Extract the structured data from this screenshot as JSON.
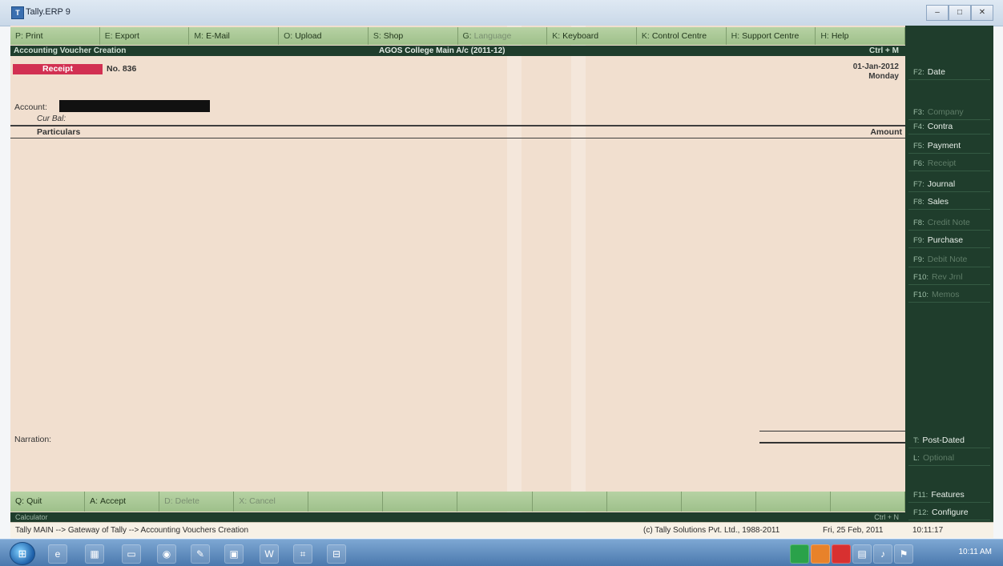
{
  "window": {
    "title": "Tally.ERP 9",
    "controls": {
      "min": "–",
      "max": "□",
      "close": "✕"
    }
  },
  "top_buttons": [
    {
      "key": "P:",
      "label": "Print",
      "dim": false
    },
    {
      "key": "E:",
      "label": "Export",
      "dim": false
    },
    {
      "key": "M:",
      "label": "E-Mail",
      "dim": false
    },
    {
      "key": "O:",
      "label": "Upload",
      "dim": false
    },
    {
      "key": "S:",
      "label": "Shop",
      "dim": false
    },
    {
      "key": "G:",
      "label": "Language",
      "dim": true
    },
    {
      "key": "K:",
      "label": "Keyboard",
      "dim": false
    },
    {
      "key": "K:",
      "label": "Control Centre",
      "dim": false
    },
    {
      "key": "H:",
      "label": "Support Centre",
      "dim": false
    },
    {
      "key": "H:",
      "label": "Help",
      "dim": false
    }
  ],
  "header": {
    "screen_title": "Accounting Voucher Creation",
    "company": "AGOS College Main A/c (2011-12)",
    "shortcut": "Ctrl + M"
  },
  "voucher": {
    "type": "Receipt",
    "number": "No. 836",
    "date": "01-Jan-2012",
    "day": "Monday",
    "account_label": "Account:",
    "current_balance_label": "Cur Bal:",
    "particulars_header": "Particulars",
    "amount_header": "Amount",
    "narration_label": "Narration:"
  },
  "bottom_buttons": [
    {
      "key": "Q:",
      "label": "Quit",
      "dim": false
    },
    {
      "key": "A:",
      "label": "Accept",
      "dim": false
    },
    {
      "key": "D:",
      "label": "Delete",
      "dim": true
    },
    {
      "key": "X:",
      "label": "Cancel",
      "dim": true
    },
    {
      "key": "",
      "label": "",
      "dim": true
    },
    {
      "key": "",
      "label": "",
      "dim": true
    },
    {
      "key": "",
      "label": "",
      "dim": true
    },
    {
      "key": "",
      "label": "",
      "dim": true
    },
    {
      "key": "",
      "label": "",
      "dim": true
    },
    {
      "key": "",
      "label": "",
      "dim": true
    },
    {
      "key": "",
      "label": "",
      "dim": true
    },
    {
      "key": "",
      "label": "",
      "dim": true
    }
  ],
  "bottom_strip": {
    "left": "Calculator",
    "right": "Ctrl + N"
  },
  "status_bar": {
    "path": "Tally MAIN --> Gateway of Tally --> Accounting Vouchers Creation",
    "copyright": "(c) Tally Solutions Pvt. Ltd., 1988-2011",
    "date": "Fri, 25 Feb, 2011",
    "time": "10:11:17"
  },
  "right_panel": [
    {
      "key": "F2:",
      "label": "Date",
      "dim": false,
      "y": 0
    },
    {
      "key": "F3:",
      "label": "Company",
      "dim": true,
      "y": 1
    },
    {
      "key": "F4:",
      "label": "Contra",
      "dim": false,
      "y": 2
    },
    {
      "key": "F5:",
      "label": "Payment",
      "dim": false,
      "y": 3
    },
    {
      "key": "F6:",
      "label": "Receipt",
      "dim": true,
      "y": 4
    },
    {
      "key": "F7:",
      "label": "Journal",
      "dim": false,
      "y": 5
    },
    {
      "key": "F8:",
      "label": "Sales",
      "dim": false,
      "y": 6
    },
    {
      "key": "F8:",
      "label": "Credit Note",
      "dim": true,
      "y": 7
    },
    {
      "key": "F9:",
      "label": "Purchase",
      "dim": false,
      "y": 8
    },
    {
      "key": "F9:",
      "label": "Debit Note",
      "dim": true,
      "y": 9
    },
    {
      "key": "F10:",
      "label": "Rev Jrnl",
      "dim": true,
      "y": 10
    },
    {
      "key": "F10:",
      "label": "Memos",
      "dim": true,
      "y": 11
    }
  ],
  "right_panel_bottom": [
    {
      "key": "T:",
      "label": "Post-Dated",
      "dim": false
    },
    {
      "key": "L:",
      "label": "Optional",
      "dim": true
    },
    {
      "key": "F11:",
      "label": "Features",
      "dim": false
    },
    {
      "key": "F12:",
      "label": "Configure",
      "dim": false
    }
  ],
  "taskbar": {
    "start": "⊞",
    "icons": [
      "e",
      "▦",
      "▭",
      "◉",
      "✎",
      "▣",
      "W",
      "⌗",
      "⊟"
    ],
    "clock": "10:11 AM"
  }
}
